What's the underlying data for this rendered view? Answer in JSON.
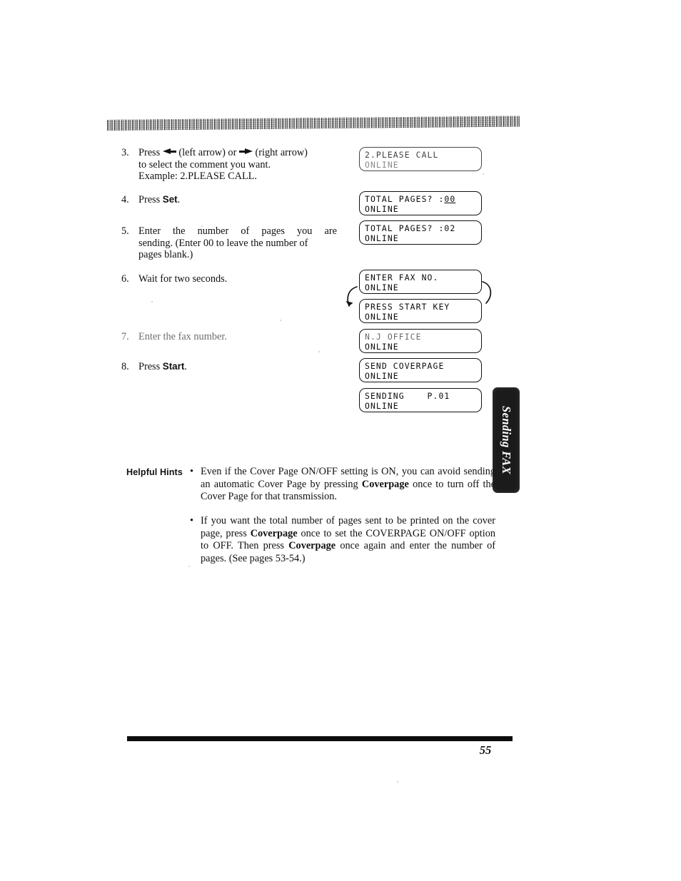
{
  "document": {
    "page_number": "55",
    "side_tab_label": "Sending FAX"
  },
  "steps": [
    {
      "number": "3.",
      "line1_before_arrows": "Press ",
      "left_arrow_caption": "(left arrow)",
      "between_arrows": " or ",
      "right_arrow_caption": "(right arrow)",
      "line2": "to select the comment you want.",
      "line3": "Example: 2.PLEASE CALL."
    },
    {
      "number": "4.",
      "text_before_key": "Press ",
      "key": "Set",
      "text_after_key": "."
    },
    {
      "number": "5.",
      "line1": "Enter the number of pages you are",
      "line2": "sending. (Enter 00 to leave the number of",
      "line3": "pages blank.)"
    },
    {
      "number": "6.",
      "text": "Wait for two seconds."
    },
    {
      "number": "7.",
      "text": "Enter the fax number."
    },
    {
      "number": "8.",
      "text_before_key": "Press ",
      "key": "Start",
      "text_after_key": "."
    }
  ],
  "lcd_displays": [
    {
      "name": "please-call",
      "line1": "2.PLEASE CALL",
      "line2": "ONLINE"
    },
    {
      "name": "total-pages-00",
      "line1_prefix": "TOTAL PAGES? :",
      "line1_underlined": "00",
      "line2": "ONLINE"
    },
    {
      "name": "total-pages-02",
      "line1": "TOTAL PAGES? :02",
      "line2": "ONLINE"
    },
    {
      "name": "enter-fax-no",
      "line1": "ENTER FAX NO.",
      "line2": "ONLINE"
    },
    {
      "name": "press-start-key",
      "line1": "PRESS START KEY",
      "line2": "ONLINE"
    },
    {
      "name": "nj-office",
      "line1": "N.J OFFICE",
      "line2": "ONLINE"
    },
    {
      "name": "send-coverpage",
      "line1": "SEND COVERPAGE",
      "line2": "ONLINE"
    },
    {
      "name": "sending-p01",
      "line1": "SENDING    P.01",
      "line2": "ONLINE"
    }
  ],
  "helpful_hints": {
    "label": "Helpful Hints",
    "bullet_glyph": "•",
    "items": [
      {
        "part1": "Even if the Cover Page ON/OFF setting is ON, you can avoid sending an automatic Cover Page by pressing ",
        "bold1": "Coverpage",
        "part2": " once to turn off the Cover Page for that transmission."
      },
      {
        "part1": "If you want the total number of pages sent to be printed on the cover page, press ",
        "bold1": "Coverpage",
        "part2": " once to set the COVERPAGE ON/OFF option to OFF. Then press ",
        "bold2": "Coverpage",
        "part3": " once again and enter the number of pages. (See pages 53-54.)"
      }
    ]
  }
}
